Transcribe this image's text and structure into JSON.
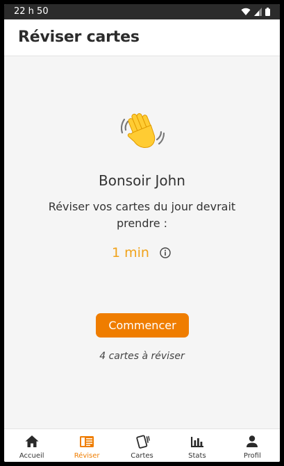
{
  "status_bar": {
    "time": "22 h 50",
    "icons": [
      "wifi-icon",
      "signal-icon",
      "battery-icon"
    ]
  },
  "app_bar": {
    "title": "Réviser cartes"
  },
  "main": {
    "emoji": "waving-hand-icon",
    "greeting": "Bonsoir John",
    "subtitle": "Réviser vos cartes du jour devrait prendre :",
    "duration": "1 min",
    "start_label": "Commencer",
    "cards_count": "4 cartes à réviser"
  },
  "bottom_nav": {
    "items": [
      {
        "label": "Accueil",
        "icon": "home-icon",
        "active": false
      },
      {
        "label": "Réviser",
        "icon": "review-icon",
        "active": true
      },
      {
        "label": "Cartes",
        "icon": "cards-icon",
        "active": false
      },
      {
        "label": "Stats",
        "icon": "stats-icon",
        "active": false
      },
      {
        "label": "Profil",
        "icon": "profile-icon",
        "active": false
      }
    ]
  },
  "colors": {
    "accent": "#ef7d00",
    "duration": "#f0a21a",
    "status_bar": "#2b2b2b",
    "background": "#f5f5f5"
  }
}
